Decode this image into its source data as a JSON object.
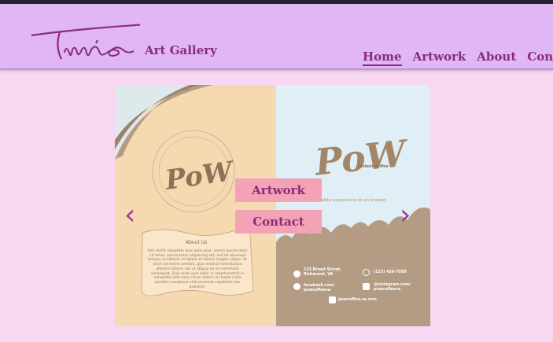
{
  "header": {
    "logo_text": "Time",
    "brand": "Art Gallery",
    "nav": [
      {
        "label": "Home",
        "active": true
      },
      {
        "label": "Artwork",
        "active": false
      },
      {
        "label": "About",
        "active": false
      },
      {
        "label": "Contact",
        "active": false
      }
    ]
  },
  "slide": {
    "left_logo": "PoW",
    "ring_text": "•POW• A pleasurable experience in an instant • A pleasurable experience in an instant • POW•",
    "about_title": "About Us",
    "about_body": "Ami mollit voluptate quis aute esse. Lorem ipsum dolor sit amet, consectetur adipiscing elit, sed do eiusmod tempor incididunt ut labore et dolore magna aliqua. Ut enim ad minim veniam, quis nostrud exercitation ullamco laboris nisi ut aliquip ex ea commodo consequat. Duis aute irure dolor in reprehenderit in voluptate velit esse cillum dolore eu fugiat nulla pariatur excepteur sint occaecat cupidatat non proident.",
    "right_logo": "PoW",
    "right_sub": "instant coffee",
    "tagline": "A pleasurable experience in an instant",
    "address": "123 Broad Street,\nRichmond, VA",
    "phone": "(123) 456-7890",
    "facebook": "facebook.com/\npowcoffeeva",
    "instagram": "@instagram.com/\npowcoffeeva",
    "website": "powcoffee.va.com"
  },
  "overlay": {
    "artwork_label": "Artwork",
    "contact_label": "Contact"
  },
  "arrows": {
    "prev": "‹",
    "next": "›"
  },
  "colors": {
    "header_bg": "#e0b6f5",
    "page_bg": "#f8d7f2",
    "accent": "#8a2c7a",
    "button_bg": "#f3a3b5"
  }
}
